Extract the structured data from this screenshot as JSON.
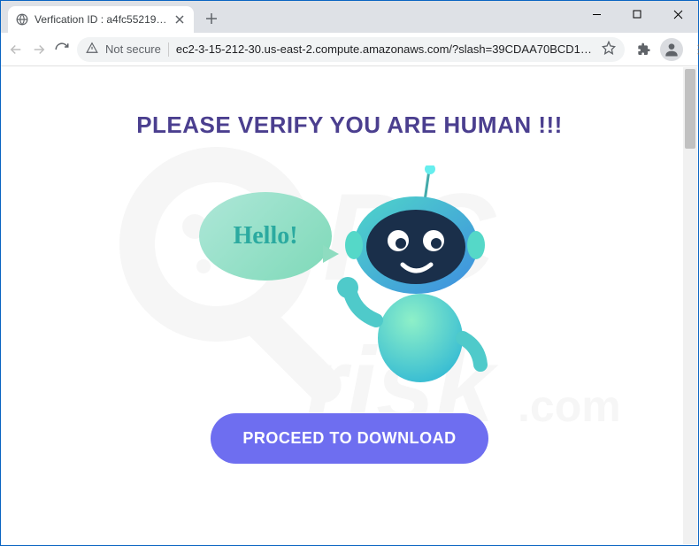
{
  "browser": {
    "tab_title": "Verfication ID : a4fc552197d13d5",
    "not_secure_label": "Not secure",
    "url_display": "ec2-3-15-212-30.us-east-2.compute.amazonaws.com/?slash=39CDAA70BCD10947..."
  },
  "page": {
    "headline": "PLEASE VERIFY YOU ARE HUMAN !!!",
    "bubble_text": "Hello!",
    "cta_label": "PROCEED TO DOWNLOAD"
  },
  "watermark": {
    "text": "pcrisk.com"
  }
}
